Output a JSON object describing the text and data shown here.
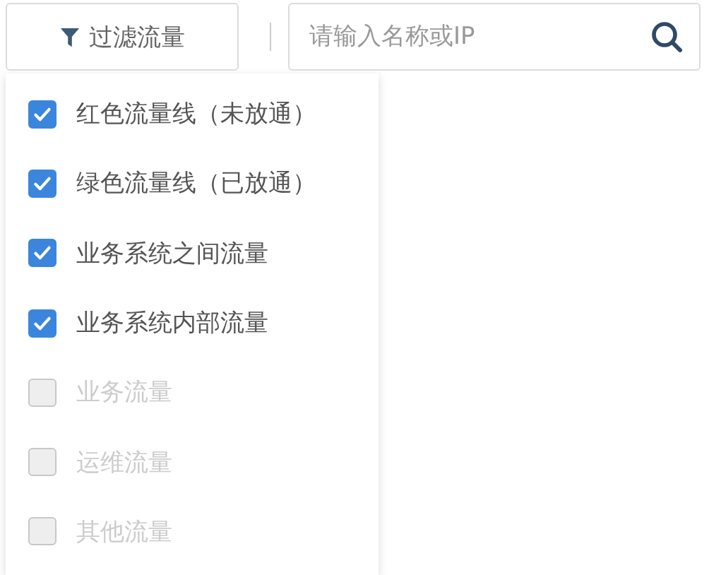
{
  "filter_button": {
    "label": "过滤流量"
  },
  "search": {
    "placeholder": "请输入名称或IP"
  },
  "filter_menu": {
    "items": [
      {
        "label": "红色流量线（未放通）",
        "checked": true,
        "disabled": false
      },
      {
        "label": "绿色流量线（已放通）",
        "checked": true,
        "disabled": false
      },
      {
        "label": "业务系统之间流量",
        "checked": true,
        "disabled": false
      },
      {
        "label": "业务系统内部流量",
        "checked": true,
        "disabled": false
      },
      {
        "label": "业务流量",
        "checked": false,
        "disabled": true
      },
      {
        "label": "运维流量",
        "checked": false,
        "disabled": true
      },
      {
        "label": "其他流量",
        "checked": false,
        "disabled": true
      }
    ]
  }
}
